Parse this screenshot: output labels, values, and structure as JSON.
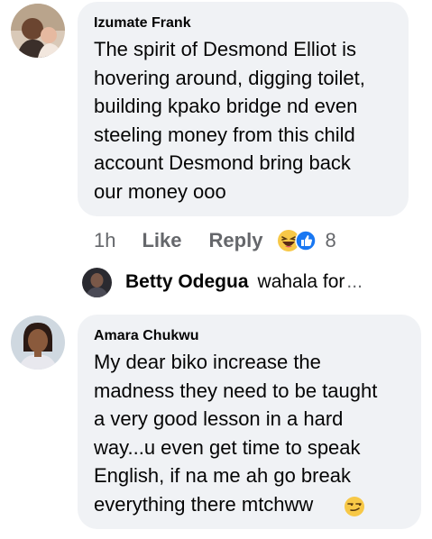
{
  "comments": [
    {
      "author": "Izumate Frank",
      "text": "The spirit of Desmond Elliot is\nhovering around, digging toilet,\nbuilding kpako bridge nd even\nsteeling money from this child\naccount Desmond bring back\nour money ooo",
      "time": "1h",
      "like_label": "Like",
      "reply_label": "Reply",
      "reaction_count": "8",
      "reactions": [
        "laughing-emoji",
        "like-reaction"
      ]
    },
    {
      "author": "Amara Chukwu",
      "text": "My dear biko increase the\nmadness they need to be taught\na very good lesson in a hard\nway...u even get time to speak\nEnglish, if na me ah go break\neverything there mtchww",
      "trailing_emoji": "smirk-emoji"
    }
  ],
  "reply_preview": {
    "author": "Betty Odegua",
    "text": "wahala for",
    "more": "..."
  },
  "colors": {
    "bubble": "#f0f2f5",
    "meta": "#65676b",
    "text": "#050505",
    "like_blue": "#1877f2",
    "emoji_yellow": "#f7c847"
  }
}
